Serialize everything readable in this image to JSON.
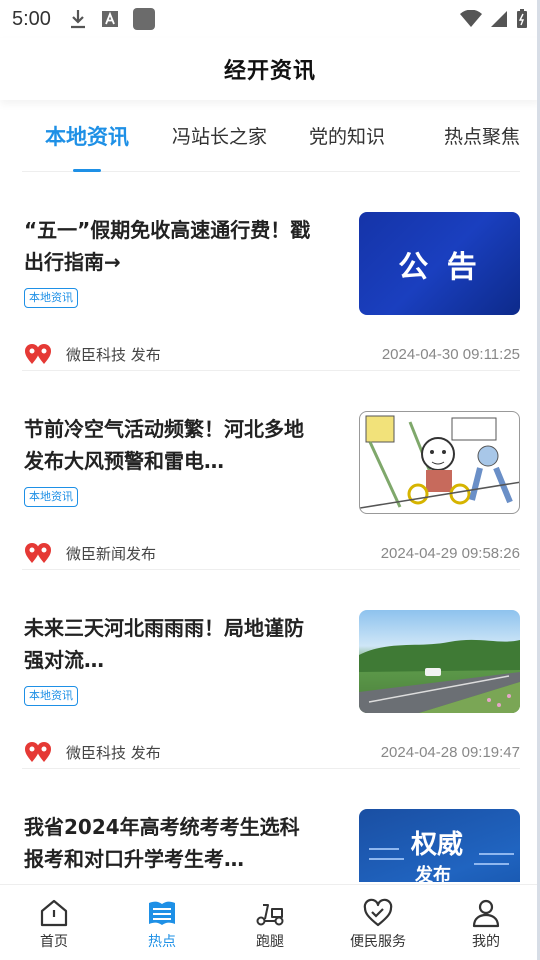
{
  "status_bar": {
    "time": "5:00"
  },
  "header": {
    "title": "经开资讯"
  },
  "tabs": [
    {
      "label": "本地资讯",
      "active": true
    },
    {
      "label": "冯站长之家",
      "active": false
    },
    {
      "label": "党的知识",
      "active": false
    },
    {
      "label": "热点聚焦",
      "active": false
    }
  ],
  "news": [
    {
      "title": "“五一”假期免收高速通行费！戳出行指南→",
      "tag": "本地资讯",
      "source": "微臣科技 发布",
      "date": "2024-04-30 09:11:25",
      "thumb_text": "公 告"
    },
    {
      "title": "节前冷空气活动频繁！河北多地发布大风预警和雷电…",
      "tag": "本地资讯",
      "source": "微臣新闻发布",
      "date": "2024-04-29 09:58:26"
    },
    {
      "title": "未来三天河北雨雨雨！局地谨防强对流…",
      "tag": "本地资讯",
      "source": "微臣科技 发布",
      "date": "2024-04-28 09:19:47"
    },
    {
      "title": "我省2024年高考统考考生选科报考和对口升学考生考…",
      "thumb_text_1": "权威",
      "thumb_text_2": "发布"
    }
  ],
  "bottom_nav": [
    {
      "label": "首页",
      "icon": "home-icon",
      "active": false
    },
    {
      "label": "热点",
      "icon": "news-icon",
      "active": true
    },
    {
      "label": "跑腿",
      "icon": "scooter-icon",
      "active": false
    },
    {
      "label": "便民服务",
      "icon": "heart-service-icon",
      "active": false
    },
    {
      "label": "我的",
      "icon": "person-icon",
      "active": false
    }
  ],
  "colors": {
    "accent": "#1e90e6",
    "source_logo_red": "#e53935"
  }
}
